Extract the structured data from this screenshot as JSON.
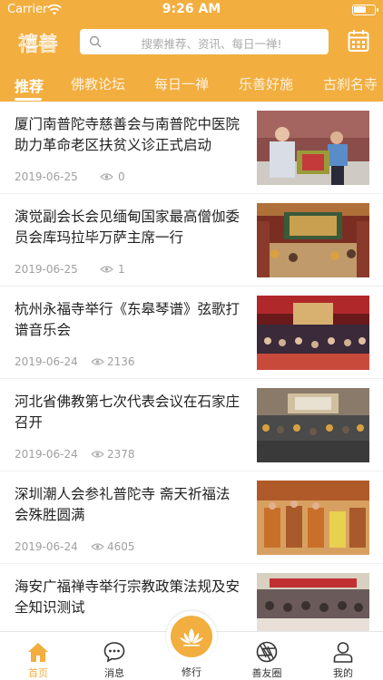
{
  "status_bar": {
    "carrier": "Carrier",
    "time": "9:26 AM",
    "battery_level": 0.5
  },
  "header": {
    "logo": "禧善",
    "search_placeholder": "搜索推荐、资讯、每日一禅!"
  },
  "tabs": [
    {
      "label": "推荐",
      "active": true
    },
    {
      "label": "佛教论坛",
      "active": false
    },
    {
      "label": "每日一禅",
      "active": false
    },
    {
      "label": "乐善好施",
      "active": false
    },
    {
      "label": "古刹名寺",
      "active": false
    }
  ],
  "articles": [
    {
      "title": "厦门南普陀寺慈善会与南普陀中医院助力革命老区扶贫义诊正式启动",
      "date": "2019-06-25",
      "views": "0"
    },
    {
      "title": "演觉副会长会见缅甸国家最高僧伽委员会库玛拉毕万萨主席一行",
      "date": "2019-06-25",
      "views": "1"
    },
    {
      "title": "杭州永福寺举行《东皋琴谱》弦歌打谱音乐会",
      "date": "2019-06-24",
      "views": "2136"
    },
    {
      "title": "河北省佛教第七次代表会议在石家庄召开",
      "date": "2019-06-24",
      "views": "2378"
    },
    {
      "title": "深圳潮人会参礼普陀寺 斋天祈福法会殊胜圆满",
      "date": "2019-06-24",
      "views": "4605"
    },
    {
      "title": "海安广福禅寺举行宗教政策法规及安全知识测试",
      "date": "",
      "views": ""
    }
  ],
  "tabbar": {
    "home": "首页",
    "messages": "消息",
    "practice": "修行",
    "friends": "善友圈",
    "mine": "我的"
  },
  "colors": {
    "accent": "#F2AE3F",
    "text": "#222222",
    "meta": "#a0a0a0"
  }
}
